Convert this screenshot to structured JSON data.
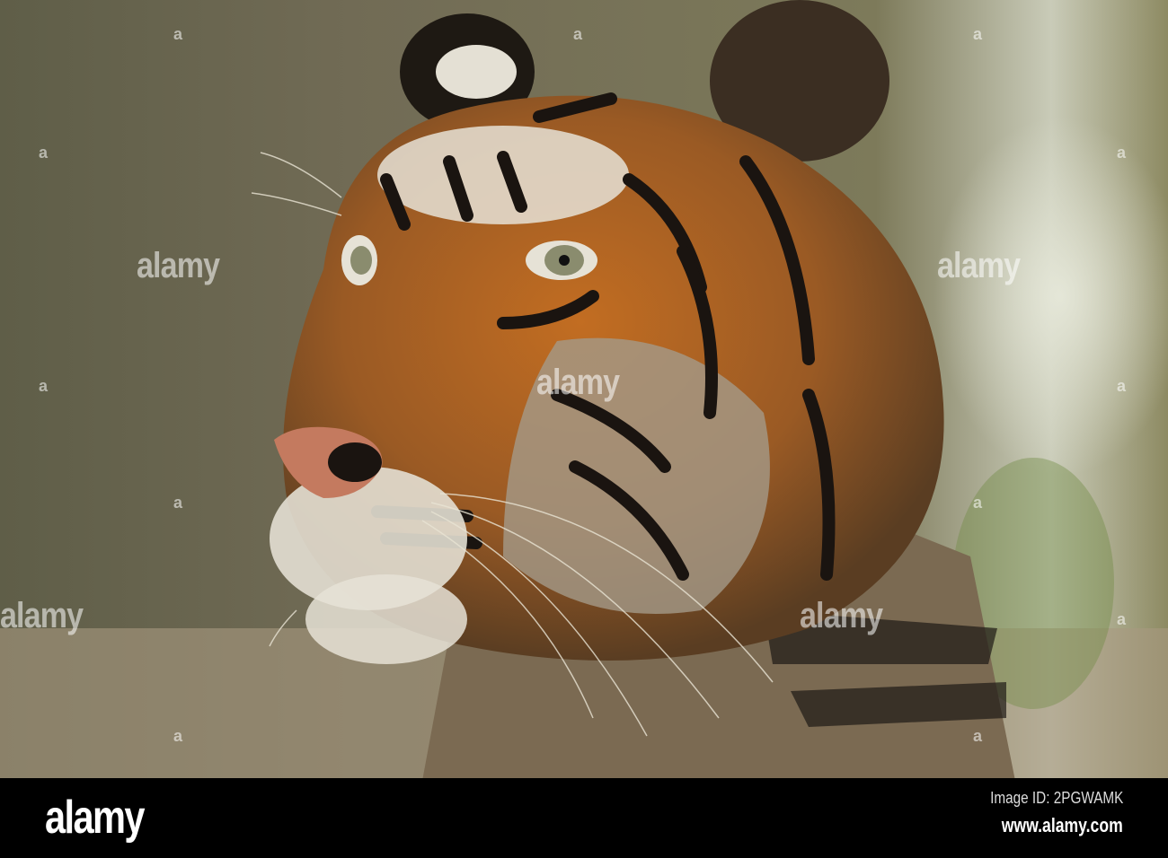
{
  "photo": {
    "subject": "tiger-portrait",
    "colors": {
      "background_left": "#5f5e48",
      "background_right": "#c9cbb8",
      "fur_orange": "#c26d22",
      "stripe": "#1a1410",
      "white_fur": "#e6e2d6",
      "nose": "#c47a5f"
    }
  },
  "watermark": {
    "text": "alamy",
    "dot": "a"
  },
  "footer": {
    "logo": "alamy",
    "image_id": "Image ID: 2PGWAMK",
    "website": "www.alamy.com"
  }
}
